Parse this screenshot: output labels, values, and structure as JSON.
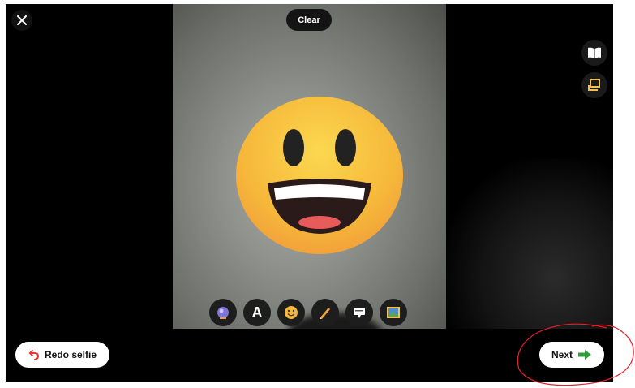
{
  "top": {
    "clear_label": "Clear"
  },
  "icons": {
    "close": "close-icon",
    "guide": "book-icon",
    "flip": "flip-card-icon",
    "toolbar": [
      "sticker-bubble-icon",
      "text-icon",
      "emoji-icon",
      "pen-icon",
      "caption-icon",
      "image-icon"
    ],
    "redo": "undo-arrow-icon",
    "next": "arrow-right-icon"
  },
  "toolbar": {
    "text_glyph": "A"
  },
  "bottom": {
    "redo_label": "Redo selfie",
    "next_label": "Next"
  },
  "colors": {
    "background": "#000000",
    "pill": "#ffffff",
    "redo_arrow": "#e53935",
    "next_arrow": "#2e9e3b",
    "annotation": "#e8202a",
    "emoji_face": "#f8c03a"
  }
}
